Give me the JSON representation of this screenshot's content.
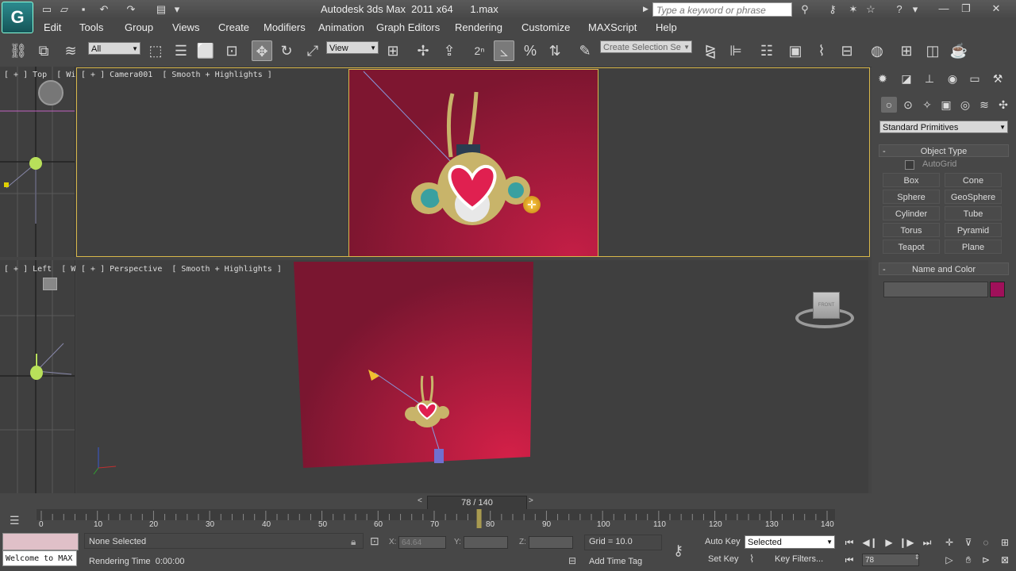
{
  "titlebar": {
    "title": "Autodesk 3ds Max  2011 x64      1.max",
    "search_placeholder": "Type a keyword or phrase",
    "logo": "G"
  },
  "menu": [
    "Edit",
    "Tools",
    "Group",
    "Views",
    "Create",
    "Modifiers",
    "Animation",
    "Graph Editors",
    "Rendering",
    "Customize",
    "MAXScript",
    "Help"
  ],
  "toolbar": {
    "selection_filter": "All",
    "reference_coord": "View",
    "named_selection_placeholder": "Create Selection Se"
  },
  "viewports": {
    "top_label": "[ + ] Top  [ Wi",
    "left_label": "[ + ] Left  [ Wi",
    "camera_label": "[ + ] Camera001  [ Smooth + Highlights ]",
    "perspective_label": "[ + ] Perspective  [ Smooth + Highlights ]",
    "viewcube_label": "FRONT"
  },
  "command_panel": {
    "category": "Standard Primitives",
    "object_type_title": "Object Type",
    "autogrid": "AutoGrid",
    "primitives": [
      "Box",
      "Cone",
      "Sphere",
      "GeoSphere",
      "Cylinder",
      "Tube",
      "Torus",
      "Pyramid",
      "Teapot",
      "Plane"
    ],
    "name_color_title": "Name and Color",
    "object_color": "#a0105a"
  },
  "timeline": {
    "frame_display": "78 / 140",
    "ticks": [
      "0",
      "10",
      "20",
      "30",
      "40",
      "50",
      "60",
      "70",
      "80",
      "90",
      "100",
      "110",
      "120",
      "130",
      "140"
    ],
    "current_frame": 78,
    "total_frames": 140
  },
  "status": {
    "maxscript_listener": "Welcome to MAX",
    "selection": "None Selected",
    "render_time": "Rendering Time  0:00:00",
    "x_label": "X:",
    "x_value": "64.64",
    "y_label": "Y:",
    "z_label": "Z:",
    "grid": "Grid = 10.0",
    "add_time_tag": "Add Time Tag",
    "auto_key": "Auto Key",
    "set_key": "Set Key",
    "key_mode": "Selected",
    "key_filters": "Key Filters...",
    "frame_field": "78"
  },
  "colors": {
    "accent": "#2c8a8e",
    "background_plane": "#8b1a35",
    "character": "#c8b46a"
  }
}
